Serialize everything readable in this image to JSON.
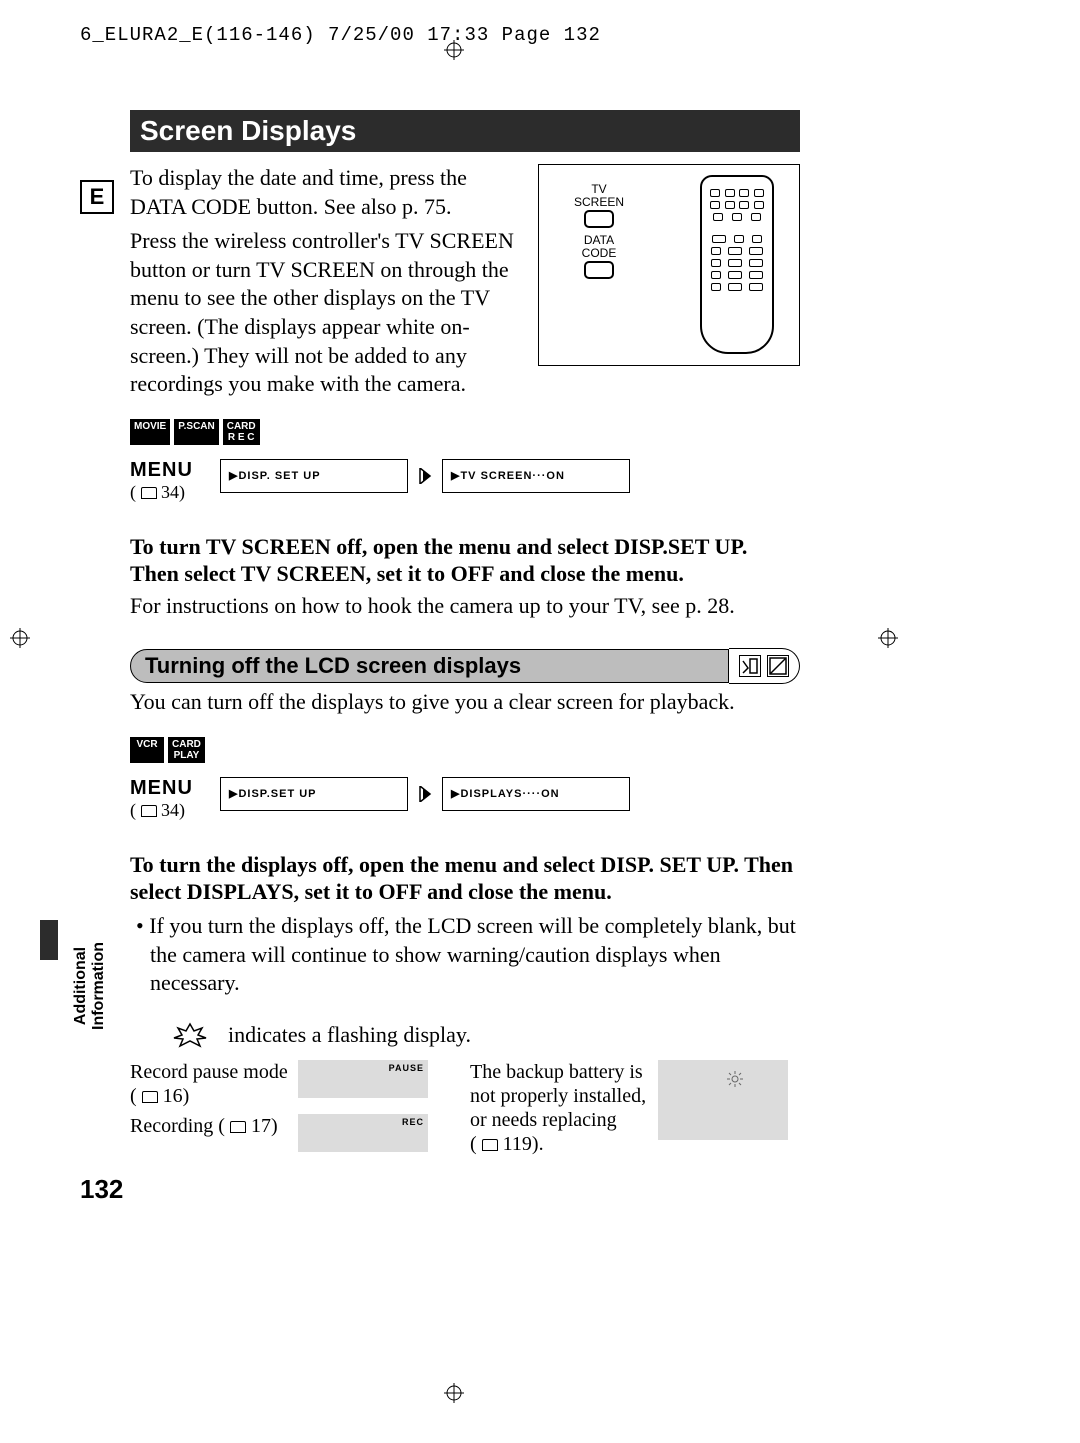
{
  "header": "6_ELURA2_E(116-146)  7/25/00 17:33  Page 132",
  "title": "Screen Displays",
  "e_label": "E",
  "intro_p1": "To display the date and time, press the DATA CODE button. See also p. 75.",
  "intro_p2": "Press the wireless controller's TV SCREEN button or turn TV SCREEN on through the menu to see the other displays on the TV screen. (The displays appear white on-screen.) They will not be added to any recordings you make with the camera.",
  "remote": {
    "label1_line1": "TV",
    "label1_line2": "SCREEN",
    "label2_line1": "DATA",
    "label2_line2": "CODE"
  },
  "mode_icons_1": [
    "MOVIE",
    "P.SCAN"
  ],
  "mode_icons_1_twoline": {
    "top": "CARD",
    "bottom": "R E C"
  },
  "menu_label": "MENU",
  "menu_ref": "34)",
  "menu1_step1": "▶DISP. SET UP",
  "menu1_step2": "▶TV SCREEN···ON",
  "bold1": "To turn TV SCREEN off, open the menu and select DISP.SET UP. Then select TV SCREEN, set it to OFF and close the menu.",
  "plain1": "For instructions on how to hook the camera up to your TV, see p. 28.",
  "subheading": "Turning off the LCD screen displays",
  "plain2": "You can turn off the displays to give you a clear screen for playback.",
  "mode_icons_2": [
    "VCR"
  ],
  "mode_icons_2_twoline": {
    "top": "CARD",
    "bottom": "PLAY"
  },
  "menu2_step1": "▶DISP.SET UP",
  "menu2_step2": "▶DISPLAYS····ON",
  "bold2": "To turn the displays off, open the menu and select DISP. SET UP. Then select DISPLAYS, set it to OFF and close the menu.",
  "bullet1": "• If you turn the displays off, the LCD screen will be completely blank, but the camera will continue to show warning/caution displays when necessary.",
  "flash_text": "indicates a flashing display.",
  "displays": {
    "left": [
      {
        "text": "Record pause mode",
        "ref": "16)",
        "tag": "PAUSE"
      },
      {
        "text": "Recording (",
        "ref": "17)",
        "tag": "REC"
      }
    ],
    "right": [
      {
        "text": "The backup battery is not properly installed, or needs replacing",
        "ref": "119).",
        "icon": "sun"
      }
    ]
  },
  "side_label_line1": "Additional",
  "side_label_line2": "Information",
  "page_number": "132"
}
